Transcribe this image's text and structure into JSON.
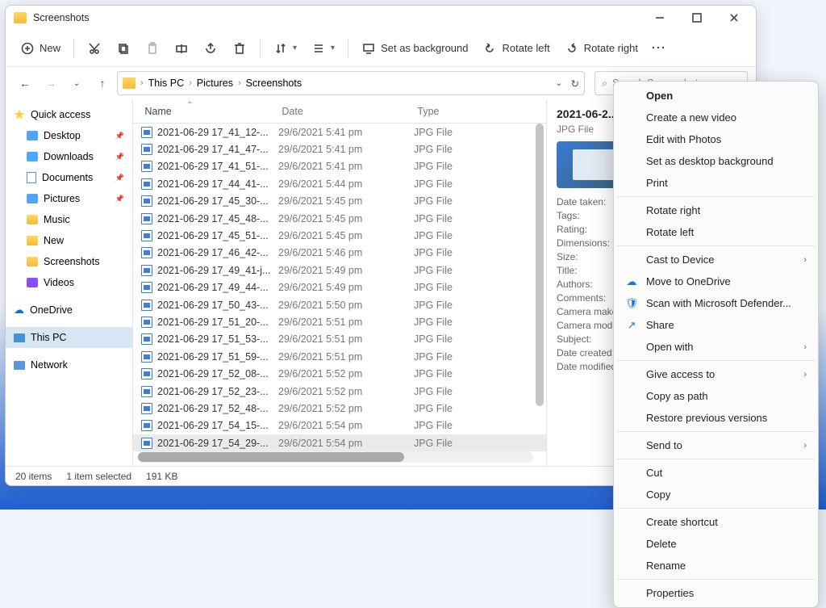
{
  "title": "Screenshots",
  "wincontrols": {
    "min": "—",
    "max": "▢",
    "close": "✕"
  },
  "toolbar": {
    "new": "New",
    "set_bg": "Set as background",
    "rotate_left": "Rotate left",
    "rotate_right": "Rotate right"
  },
  "breadcrumb": [
    "This PC",
    "Pictures",
    "Screenshots"
  ],
  "search_placeholder": "Search Screenshots",
  "columns": {
    "name": "Name",
    "date": "Date",
    "type": "Type"
  },
  "sidebar": {
    "quick": "Quick access",
    "items": [
      {
        "label": "Desktop",
        "icon": "blue",
        "pin": true
      },
      {
        "label": "Downloads",
        "icon": "blue",
        "pin": true
      },
      {
        "label": "Documents",
        "icon": "doc",
        "pin": true
      },
      {
        "label": "Pictures",
        "icon": "blue",
        "pin": true
      },
      {
        "label": "Music",
        "icon": "fold",
        "pin": false
      },
      {
        "label": "New",
        "icon": "fold",
        "pin": false
      },
      {
        "label": "Screenshots",
        "icon": "fold",
        "pin": false
      },
      {
        "label": "Videos",
        "icon": "purple",
        "pin": false
      }
    ],
    "onedrive": "OneDrive",
    "thispc": "This PC",
    "network": "Network"
  },
  "files": [
    {
      "name": "2021-06-29 17_41_12-...",
      "date": "29/6/2021 5:41 pm",
      "type": "JPG File"
    },
    {
      "name": "2021-06-29 17_41_47-...",
      "date": "29/6/2021 5:41 pm",
      "type": "JPG File"
    },
    {
      "name": "2021-06-29 17_41_51-...",
      "date": "29/6/2021 5:41 pm",
      "type": "JPG File"
    },
    {
      "name": "2021-06-29 17_44_41-...",
      "date": "29/6/2021 5:44 pm",
      "type": "JPG File"
    },
    {
      "name": "2021-06-29 17_45_30-...",
      "date": "29/6/2021 5:45 pm",
      "type": "JPG File"
    },
    {
      "name": "2021-06-29 17_45_48-...",
      "date": "29/6/2021 5:45 pm",
      "type": "JPG File"
    },
    {
      "name": "2021-06-29 17_45_51-...",
      "date": "29/6/2021 5:45 pm",
      "type": "JPG File"
    },
    {
      "name": "2021-06-29 17_46_42-...",
      "date": "29/6/2021 5:46 pm",
      "type": "JPG File"
    },
    {
      "name": "2021-06-29 17_49_41-j...",
      "date": "29/6/2021 5:49 pm",
      "type": "JPG File"
    },
    {
      "name": "2021-06-29 17_49_44-...",
      "date": "29/6/2021 5:49 pm",
      "type": "JPG File"
    },
    {
      "name": "2021-06-29 17_50_43-...",
      "date": "29/6/2021 5:50 pm",
      "type": "JPG File"
    },
    {
      "name": "2021-06-29 17_51_20-...",
      "date": "29/6/2021 5:51 pm",
      "type": "JPG File"
    },
    {
      "name": "2021-06-29 17_51_53-...",
      "date": "29/6/2021 5:51 pm",
      "type": "JPG File"
    },
    {
      "name": "2021-06-29 17_51_59-...",
      "date": "29/6/2021 5:51 pm",
      "type": "JPG File"
    },
    {
      "name": "2021-06-29 17_52_08-...",
      "date": "29/6/2021 5:52 pm",
      "type": "JPG File"
    },
    {
      "name": "2021-06-29 17_52_23-...",
      "date": "29/6/2021 5:52 pm",
      "type": "JPG File"
    },
    {
      "name": "2021-06-29 17_52_48-...",
      "date": "29/6/2021 5:52 pm",
      "type": "JPG File"
    },
    {
      "name": "2021-06-29 17_54_15-...",
      "date": "29/6/2021 5:54 pm",
      "type": "JPG File"
    },
    {
      "name": "2021-06-29 17_54_29-...",
      "date": "29/6/2021 5:54 pm",
      "type": "JPG File"
    }
  ],
  "preview": {
    "title": "2021-06-2...",
    "sub": "JPG File",
    "meta": [
      "Date taken:",
      "Tags:",
      "Rating:",
      "Dimensions:",
      "Size:",
      "Title:",
      "Authors:",
      "Comments:",
      "Camera maker:",
      "Camera mode",
      "Subject:",
      "Date created:",
      "Date modified"
    ]
  },
  "status": {
    "count": "20 items",
    "selected": "1 item selected",
    "size": "191 KB"
  },
  "context": {
    "groups": [
      [
        {
          "label": "Open",
          "bold": true
        },
        {
          "label": "Create a new video"
        },
        {
          "label": "Edit with Photos"
        },
        {
          "label": "Set as desktop background"
        },
        {
          "label": "Print"
        }
      ],
      [
        {
          "label": "Rotate right"
        },
        {
          "label": "Rotate left"
        }
      ],
      [
        {
          "label": "Cast to Device",
          "sub": true
        },
        {
          "label": "Move to OneDrive",
          "icon": "cloud"
        },
        {
          "label": "Scan with Microsoft Defender...",
          "icon": "shield"
        },
        {
          "label": "Share",
          "icon": "share"
        },
        {
          "label": "Open with",
          "sub": true
        }
      ],
      [
        {
          "label": "Give access to",
          "sub": true
        },
        {
          "label": "Copy as path"
        },
        {
          "label": "Restore previous versions"
        }
      ],
      [
        {
          "label": "Send to",
          "sub": true
        }
      ],
      [
        {
          "label": "Cut"
        },
        {
          "label": "Copy"
        }
      ],
      [
        {
          "label": "Create shortcut"
        },
        {
          "label": "Delete"
        },
        {
          "label": "Rename"
        }
      ],
      [
        {
          "label": "Properties"
        }
      ]
    ]
  }
}
